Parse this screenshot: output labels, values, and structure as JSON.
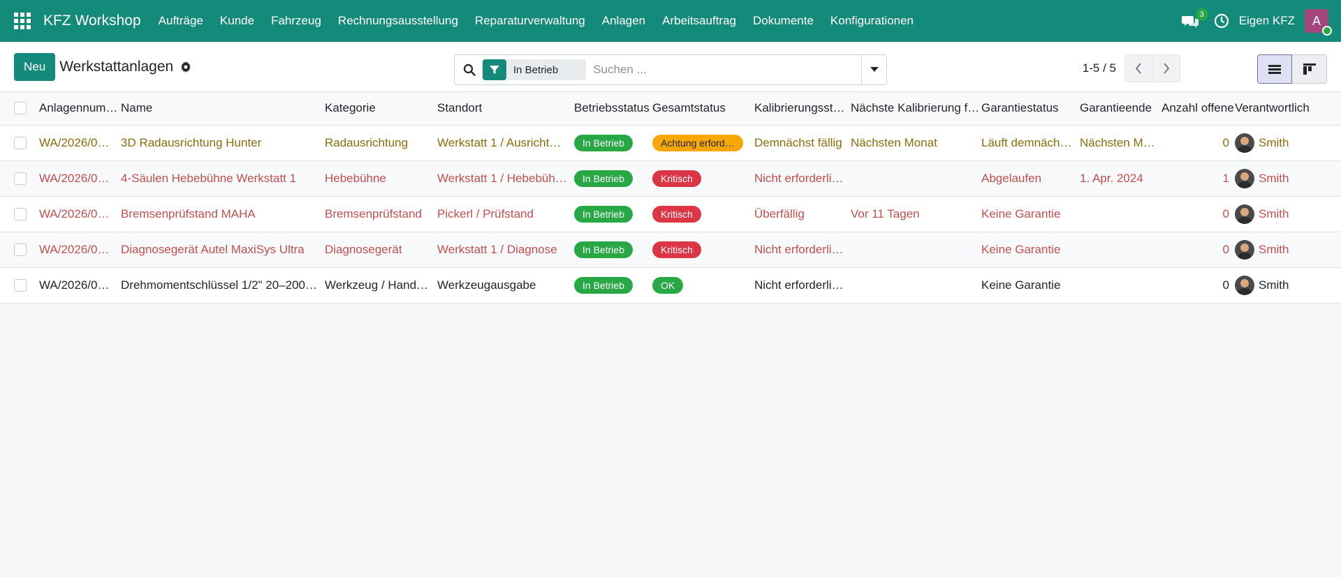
{
  "navbar": {
    "brand": "KFZ Workshop",
    "menu": [
      "Aufträge",
      "Kunde",
      "Fahrzeug",
      "Rechnungsausstellung",
      "Reparaturverwaltung",
      "Anlagen",
      "Arbeitsauftrag",
      "Dokumente",
      "Konfigurationen"
    ],
    "chat_count": "3",
    "company": "Eigen KFZ",
    "user_initial": "A"
  },
  "control_panel": {
    "new_label": "Neu",
    "title": "Werkstattanlagen",
    "facet_value": "In Betrieb",
    "search_placeholder": "Suchen ...",
    "pager": "1-5 / 5"
  },
  "table": {
    "headers": [
      "Anlagennummer",
      "Name",
      "Kategorie",
      "Standort",
      "Betriebsstatus",
      "Gesamtstatus",
      "Kalibrierungsstatus",
      "Nächste Kalibrierung fällig",
      "Garantiestatus",
      "Garantieende",
      "Anzahl offene",
      "Verantwortlich"
    ],
    "rows": [
      {
        "number": "WA/2026/0…",
        "name": "3D Radausrichtung Hunter",
        "category": "Radausrichtung",
        "location": "Werkstatt 1 / Ausricht…",
        "operating": "In Betrieb",
        "overall": "Achtung erford…",
        "calibration": "Demnächst fällig",
        "next_calibration": "Nächsten Monat",
        "warranty_status": "Läuft demnäch…",
        "warranty_end": "Nächsten Monat",
        "open_count": "0",
        "responsible": "Smith",
        "row_color": "#8a6d0b",
        "overall_color": "#f7a70a"
      },
      {
        "number": "WA/2026/0…",
        "name": "4-Säulen Hebebühne Werkstatt 1",
        "category": "Hebebühne",
        "location": "Werkstatt 1 / Hebebüh…",
        "operating": "In Betrieb",
        "overall": "Kritisch",
        "calibration": "Nicht erforderli…",
        "next_calibration": "",
        "warranty_status": "Abgelaufen",
        "warranty_end": "1. Apr. 2024",
        "open_count": "1",
        "responsible": "Smith",
        "row_color": "#c0504d",
        "overall_color": "#dc3545"
      },
      {
        "number": "WA/2026/0…",
        "name": "Bremsenprüfstand MAHA",
        "category": "Bremsenprüfstand",
        "location": "Pickerl / Prüfstand",
        "operating": "In Betrieb",
        "overall": "Kritisch",
        "calibration": "Überfällig",
        "next_calibration": "Vor 11 Tagen",
        "warranty_status": "Keine Garantie",
        "warranty_end": "",
        "open_count": "0",
        "responsible": "Smith",
        "row_color": "#c0504d",
        "overall_color": "#dc3545"
      },
      {
        "number": "WA/2026/0…",
        "name": "Diagnosegerät Autel MaxiSys Ultra",
        "category": "Diagnosegerät",
        "location": "Werkstatt 1 / Diagnose",
        "operating": "In Betrieb",
        "overall": "Kritisch",
        "calibration": "Nicht erforderli…",
        "next_calibration": "",
        "warranty_status": "Keine Garantie",
        "warranty_end": "",
        "open_count": "0",
        "responsible": "Smith",
        "row_color": "#c0504d",
        "overall_color": "#dc3545"
      },
      {
        "number": "WA/2026/0…",
        "name": "Drehmomentschlüssel 1/2\" 20–200…",
        "category": "Werkzeug / Hand…",
        "location": "Werkzeugausgabe",
        "operating": "In Betrieb",
        "overall": "OK",
        "calibration": "Nicht erforderli…",
        "next_calibration": "",
        "warranty_status": "Keine Garantie",
        "warranty_end": "",
        "open_count": "0",
        "responsible": "Smith",
        "row_color": "#212529",
        "overall_color": "#28a745"
      }
    ]
  },
  "colors": {
    "brand": "#138a7a",
    "in_betrieb": "#28a745"
  }
}
